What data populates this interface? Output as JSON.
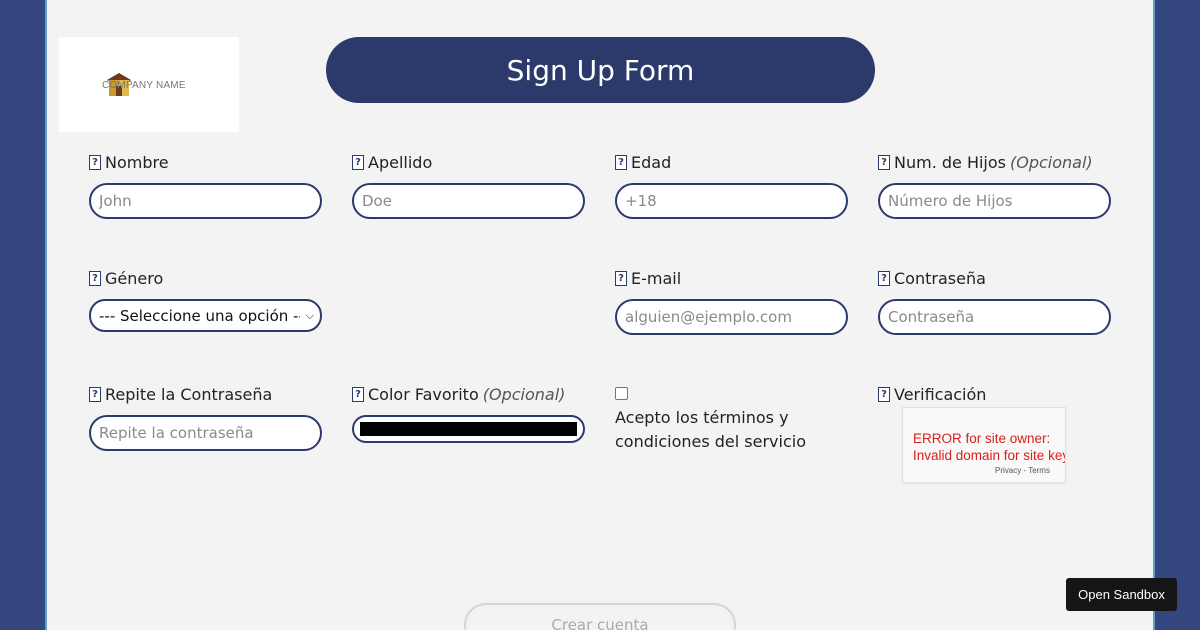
{
  "logo": {
    "text": "COMPANY NAME",
    "icon": "house-icon"
  },
  "title": "Sign Up Form",
  "fields": {
    "nombre": {
      "label": "Nombre",
      "placeholder": "John"
    },
    "apellido": {
      "label": "Apellido",
      "placeholder": "Doe"
    },
    "edad": {
      "label": "Edad",
      "placeholder": "+18"
    },
    "hijos": {
      "label": "Num. de Hijos",
      "optional": "(Opcional)",
      "placeholder": "Número de Hijos"
    },
    "genero": {
      "label": "Género",
      "selected": "--- Seleccione una opción ---"
    },
    "email": {
      "label": "E-mail",
      "placeholder": "alguien@ejemplo.com"
    },
    "password": {
      "label": "Contraseña",
      "placeholder": "Contraseña"
    },
    "repeat_password": {
      "label": "Repite la Contraseña",
      "placeholder": "Repite la contraseña"
    },
    "color": {
      "label": "Color Favorito",
      "optional": "(Opcional)",
      "value": "#000000"
    },
    "terms": {
      "text": "Acepto los términos y condiciones del servicio",
      "checked": false
    },
    "verification": {
      "label": "Verificación"
    }
  },
  "recaptcha": {
    "error_line1": "ERROR for site owner:",
    "error_line2": "Invalid domain for site key",
    "links": "Privacy - Terms"
  },
  "help_icon": "?",
  "submit": {
    "label": "Crear cuenta"
  },
  "sandbox": {
    "label": "Open Sandbox"
  },
  "colors": {
    "background": "#34467e",
    "primary": "#2b3a6b",
    "card": "#f3f3f3",
    "error": "#d91e18"
  }
}
